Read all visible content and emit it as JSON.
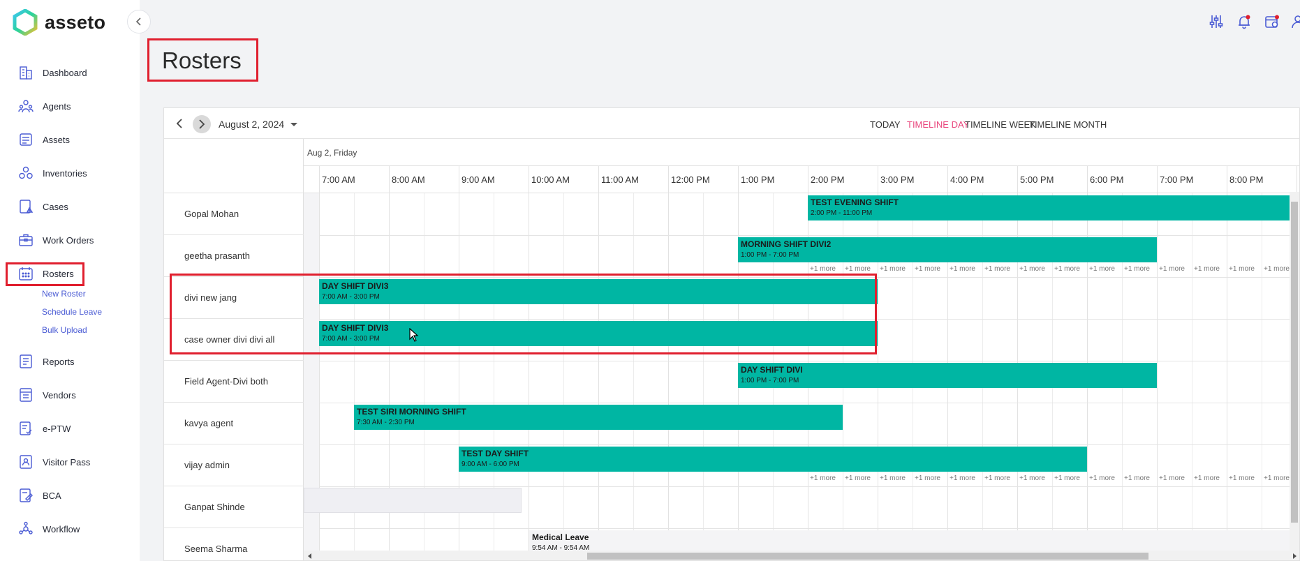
{
  "brand": {
    "name": "asseto",
    "accent": "#00b6a3",
    "highlight": "#e01f2e",
    "active_view_color": "#e9457c"
  },
  "sidebar": {
    "items": [
      {
        "id": "dashboard",
        "label": "Dashboard",
        "icon": "building-icon"
      },
      {
        "id": "agents",
        "label": "Agents",
        "icon": "agents-icon"
      },
      {
        "id": "assets",
        "label": "Assets",
        "icon": "assets-icon"
      },
      {
        "id": "inventories",
        "label": "Inventories",
        "icon": "inventories-icon"
      },
      {
        "id": "cases",
        "label": "Cases",
        "icon": "cases-icon"
      },
      {
        "id": "work-orders",
        "label": "Work Orders",
        "icon": "briefcase-icon"
      },
      {
        "id": "rosters",
        "label": "Rosters",
        "icon": "calendar-icon"
      },
      {
        "id": "reports",
        "label": "Reports",
        "icon": "reports-icon"
      },
      {
        "id": "vendors",
        "label": "Vendors",
        "icon": "vendors-icon"
      },
      {
        "id": "eptw",
        "label": "e-PTW",
        "icon": "eptw-icon"
      },
      {
        "id": "visitor-pass",
        "label": "Visitor Pass",
        "icon": "visitor-pass-icon"
      },
      {
        "id": "bca",
        "label": "BCA",
        "icon": "bca-icon"
      },
      {
        "id": "workflow",
        "label": "Workflow",
        "icon": "workflow-icon"
      }
    ],
    "rosters_sub": [
      "New Roster",
      "Schedule Leave",
      "Bulk Upload"
    ]
  },
  "page": {
    "title": "Rosters"
  },
  "toolbar": {
    "date": "August 2, 2024",
    "views": [
      "TODAY",
      "TIMELINE DAY",
      "TIMELINE WEEK",
      "TIMELINE MONTH"
    ],
    "active_view": "TIMELINE DAY"
  },
  "timeline": {
    "date_label": "Aug 2, Friday",
    "hours": [
      "7:00 AM",
      "8:00 AM",
      "9:00 AM",
      "10:00 AM",
      "11:00 AM",
      "12:00 PM",
      "1:00 PM",
      "2:00 PM",
      "3:00 PM",
      "4:00 PM",
      "5:00 PM",
      "6:00 PM",
      "7:00 PM",
      "8:00 PM"
    ],
    "resources": [
      "Gopal Mohan",
      "geetha prasanth",
      "divi new jang",
      "case owner divi divi all",
      "Field Agent-Divi both",
      "kavya agent",
      "vijay admin",
      "Ganpat Shinde",
      "Seema Sharma"
    ],
    "more_label": "+1 more",
    "events": [
      {
        "row": 0,
        "title": "TEST EVENING SHIFT",
        "time": "2:00 PM - 11:00 PM",
        "start": 14,
        "end": 23
      },
      {
        "row": 1,
        "title": "MORNING SHIFT DIVI2",
        "time": "1:00 PM - 7:00 PM",
        "start": 13,
        "end": 19
      },
      {
        "row": 2,
        "title": "DAY SHIFT DIVI3",
        "time": "7:00 AM - 3:00 PM",
        "start": 7,
        "end": 15
      },
      {
        "row": 3,
        "title": "DAY SHIFT DIVI3",
        "time": "7:00 AM - 3:00 PM",
        "start": 7,
        "end": 15
      },
      {
        "row": 4,
        "title": "DAY SHIFT DIVI",
        "time": "1:00 PM - 7:00 PM",
        "start": 13,
        "end": 19
      },
      {
        "row": 5,
        "title": "TEST SIRI MORNING SHIFT",
        "time": "7:30 AM - 2:30 PM",
        "start": 7.5,
        "end": 14.5
      },
      {
        "row": 6,
        "title": "TEST DAY SHIFT",
        "time": "9:00 AM - 6:00 PM",
        "start": 9,
        "end": 18
      },
      {
        "row": 8,
        "title": "Medical Leave",
        "time": "9:54 AM - 9:54 AM",
        "start": 10,
        "end": 24,
        "kind": "leave"
      }
    ]
  }
}
